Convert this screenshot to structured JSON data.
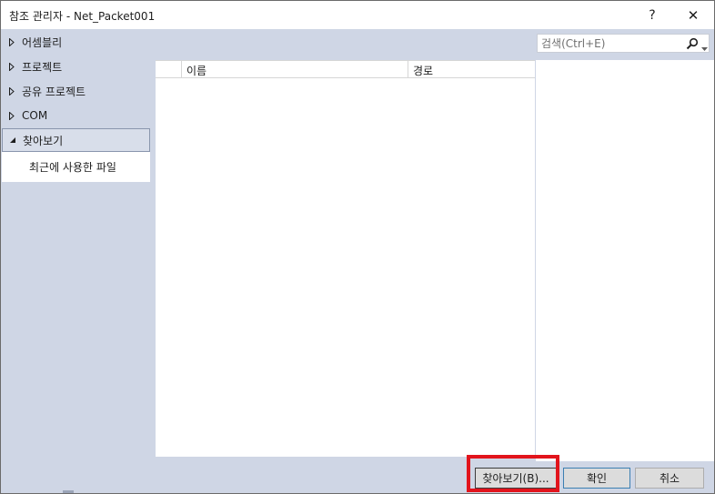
{
  "window": {
    "title": "참조 관리자 - Net_Packet001",
    "help_label": "?",
    "close_label": "✕"
  },
  "sidebar": {
    "items": [
      {
        "label": "어셈블리",
        "icon": "caret-right-icon",
        "expanded": false
      },
      {
        "label": "프로젝트",
        "icon": "caret-right-icon",
        "expanded": false
      },
      {
        "label": "공유 프로젝트",
        "icon": "caret-right-icon",
        "expanded": false
      },
      {
        "label": "COM",
        "icon": "caret-right-icon",
        "expanded": false
      },
      {
        "label": "찾아보기",
        "icon": "caret-down-icon",
        "expanded": true,
        "selected": true
      }
    ],
    "subitems": [
      {
        "label": "최근에 사용한 파일"
      }
    ]
  },
  "grid": {
    "columns": [
      "",
      "이름",
      "경로"
    ],
    "rows": []
  },
  "search": {
    "placeholder": "검색(Ctrl+E)",
    "value": ""
  },
  "footer": {
    "browse_label": "찾아보기(B)...",
    "ok_label": "확인",
    "cancel_label": "취소"
  },
  "colors": {
    "panel_bg": "#cfd6e5",
    "highlight": "#e2141c",
    "ok_border": "#3c7fb1"
  }
}
